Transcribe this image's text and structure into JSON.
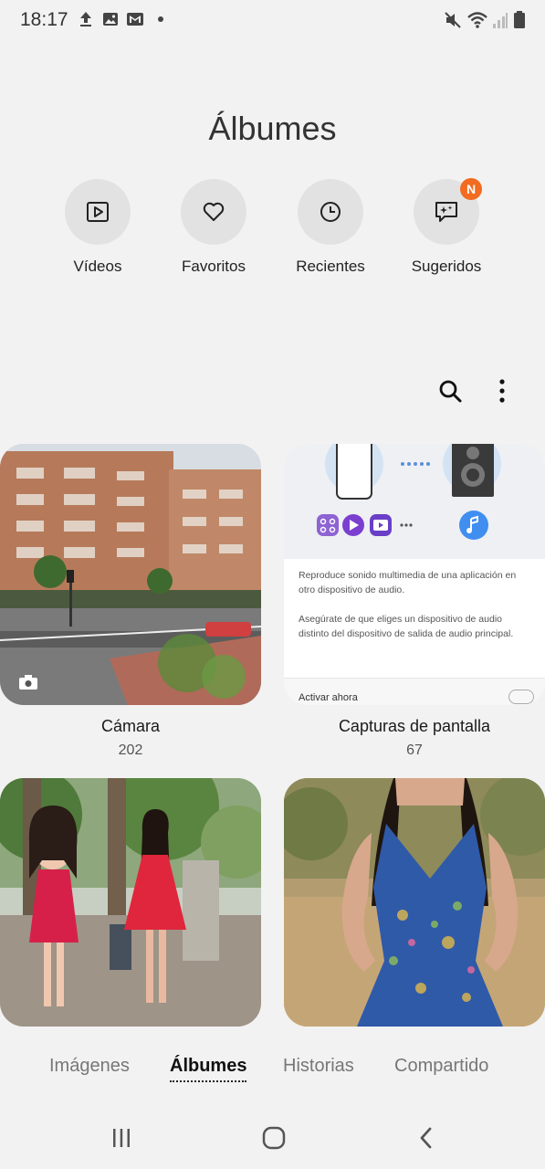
{
  "status_bar": {
    "time": "18:17"
  },
  "header": {
    "title": "Álbumes"
  },
  "shortcuts": [
    {
      "label": "Vídeos",
      "icon": "video-icon"
    },
    {
      "label": "Favoritos",
      "icon": "heart-icon"
    },
    {
      "label": "Recientes",
      "icon": "clock-icon"
    },
    {
      "label": "Sugeridos",
      "icon": "sparkle-chat-icon",
      "badge": "N"
    }
  ],
  "albums": [
    {
      "name": "Cámara",
      "count": "202"
    },
    {
      "name": "Capturas de pantalla",
      "count": "67",
      "preview_text_1": "Reproduce sonido multimedia de una aplicación en otro dispositivo de audio.",
      "preview_text_2": "Asegúrate de que eliges un dispositivo de audio distinto del dispositivo de salida de audio principal.",
      "preview_toggle_label": "Activar ahora"
    },
    {
      "name": "",
      "count": ""
    },
    {
      "name": "",
      "count": ""
    }
  ],
  "tabs": [
    {
      "label": "Imágenes"
    },
    {
      "label": "Álbumes",
      "active": true
    },
    {
      "label": "Historias"
    },
    {
      "label": "Compartido"
    }
  ],
  "colors": {
    "accent_badge": "#f26b20",
    "background": "#f2f2f2"
  }
}
